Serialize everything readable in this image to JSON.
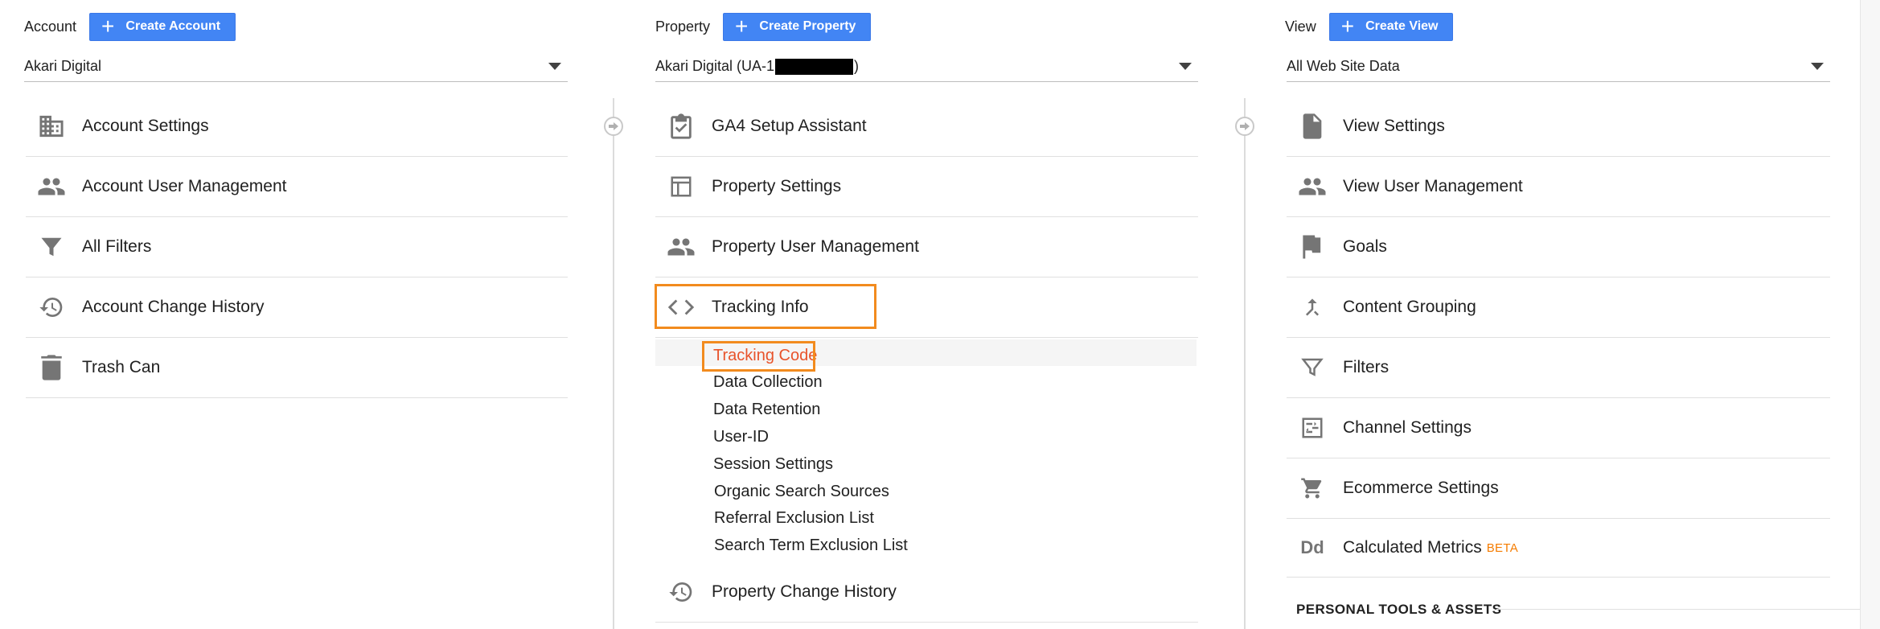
{
  "account": {
    "label": "Account",
    "create_button": "Create Account",
    "selected": "Akari Digital",
    "items": [
      {
        "label": "Account Settings",
        "icon": "building-icon"
      },
      {
        "label": "Account User Management",
        "icon": "people-icon"
      },
      {
        "label": "All Filters",
        "icon": "filter-icon"
      },
      {
        "label": "Account Change History",
        "icon": "history-icon"
      },
      {
        "label": "Trash Can",
        "icon": "trash-icon"
      }
    ]
  },
  "property": {
    "label": "Property",
    "create_button": "Create Property",
    "selected_prefix": "Akari Digital (UA-1",
    "selected_suffix": ")",
    "items": [
      {
        "label": "GA4 Setup Assistant",
        "icon": "checklist-icon"
      },
      {
        "label": "Property Settings",
        "icon": "layout-icon"
      },
      {
        "label": "Property User Management",
        "icon": "people-icon"
      },
      {
        "label": "Tracking Info",
        "icon": "code-icon"
      }
    ],
    "tracking_sub": [
      "Tracking Code",
      "Data Collection",
      "Data Retention",
      "User-ID",
      "Session Settings",
      "Organic Search Sources",
      "Referral Exclusion List",
      "Search Term Exclusion List"
    ],
    "change_history": "Property Change History"
  },
  "view": {
    "label": "View",
    "create_button": "Create View",
    "selected": "All Web Site Data",
    "items": [
      {
        "label": "View Settings",
        "icon": "document-icon"
      },
      {
        "label": "View User Management",
        "icon": "people-icon"
      },
      {
        "label": "Goals",
        "icon": "flag-icon"
      },
      {
        "label": "Content Grouping",
        "icon": "merge-icon"
      },
      {
        "label": "Filters",
        "icon": "filter-icon"
      },
      {
        "label": "Channel Settings",
        "icon": "channel-icon"
      },
      {
        "label": "Ecommerce Settings",
        "icon": "cart-icon"
      },
      {
        "label": "Calculated Metrics",
        "icon": "dd-icon",
        "badge": "BETA"
      }
    ],
    "section_title": "PERSONAL TOOLS & ASSETS"
  },
  "colors": {
    "button_blue": "#4285f4",
    "highlight_orange": "#f28b1e",
    "active_link": "#e8532b",
    "icon_gray": "#757575"
  }
}
